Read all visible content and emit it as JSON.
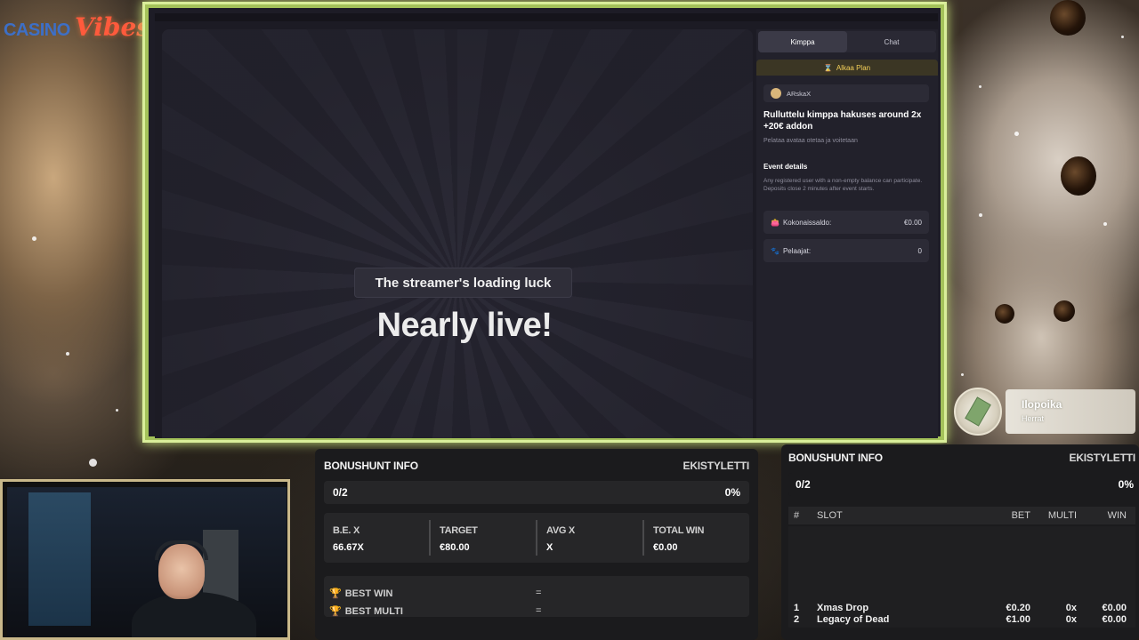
{
  "logo": {
    "part1": "CASINO",
    "part2": "Vibes"
  },
  "stream": {
    "tabs": [
      {
        "label": "Kimppa",
        "active": true
      },
      {
        "label": "Chat",
        "active": false
      }
    ],
    "event_badge": "Alkaa Plan",
    "host_user": "ARskaX",
    "event_title": "Rulluttelu kimppa hakuses around 2x +20€ addon",
    "event_subtitle": "Pelataa avataa otetaa ja voitetaan",
    "details_heading": "Event details",
    "details_text": "Any registered user with a non-empty balance can participate. Deposits close 2 minutes after event starts.",
    "stats": [
      {
        "icon": "wallet-icon",
        "label": "Kokonaissaldo:",
        "value": "€0.00"
      },
      {
        "icon": "paw-icon",
        "label": "Pelaajat:",
        "value": "0"
      }
    ],
    "loading_text": "The streamer's loading luck",
    "headline": "Nearly live!"
  },
  "follower_alert": {
    "name": "Ilopoika",
    "subtitle": "Herrat"
  },
  "bonushunt_left": {
    "title": "BONUSHUNT INFO",
    "author": "EKISTYLETTI",
    "progress": "0/2",
    "percent": "0%",
    "stats": [
      {
        "key": "B.E. X",
        "value": "66.67X"
      },
      {
        "key": "TARGET",
        "value": "€80.00"
      },
      {
        "key": "AVG X",
        "value": "X"
      },
      {
        "key": "TOTAL WIN",
        "value": "€0.00"
      }
    ],
    "best_win_label": "BEST WIN",
    "best_win_value": "=",
    "best_multi_label": "BEST MULTI",
    "best_multi_value": "="
  },
  "bonushunt_right": {
    "title": "BONUSHUNT INFO",
    "author": "EKISTYLETTI",
    "progress": "0/2",
    "percent": "0%",
    "columns": [
      "#",
      "SLOT",
      "BET",
      "MULTI",
      "WIN"
    ],
    "rows": [
      {
        "n": "1",
        "slot": "Xmas Drop",
        "bet": "€0.20",
        "multi": "0x",
        "win": "€0.00"
      },
      {
        "n": "2",
        "slot": "Legacy of Dead",
        "bet": "€1.00",
        "multi": "0x",
        "win": "€0.00"
      }
    ]
  },
  "colors": {
    "frame_border": "#d9ee9a",
    "logo_vibes": "#ff5a3c",
    "logo_casino": "#3d6fc6",
    "event_accent": "#f3cf59"
  }
}
